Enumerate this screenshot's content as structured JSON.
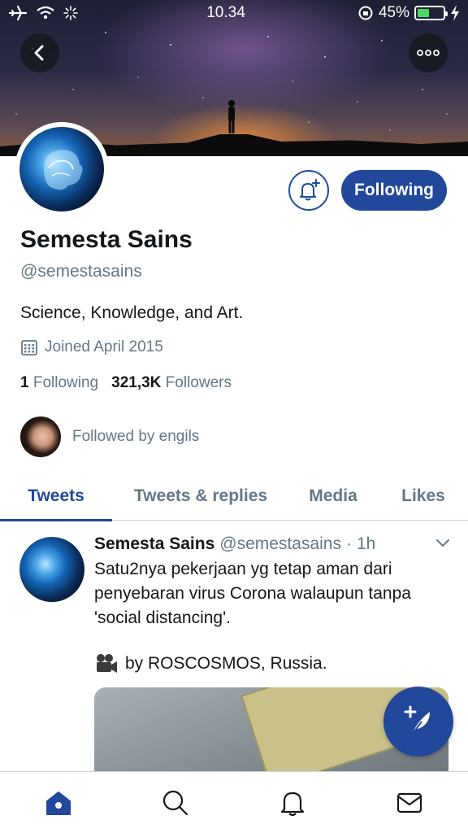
{
  "status_bar": {
    "time": "10.34",
    "battery_percent": "45%",
    "battery_level": 0.45
  },
  "header": {
    "back_icon": "back-arrow-icon",
    "more_icon": "more-dots-icon"
  },
  "profile": {
    "name": "Semesta Sains",
    "handle": "@semestasains",
    "bio": "Science, Knowledge, and Art.",
    "joined": "Joined April 2015",
    "following_count": "1",
    "following_label": "Following",
    "followers_count": "321,3K",
    "followers_label": "Followers",
    "followed_by": "Followed by engils",
    "follow_button_label": "Following"
  },
  "tabs": [
    {
      "label": "Tweets",
      "active": true
    },
    {
      "label": "Tweets & replies",
      "active": false
    },
    {
      "label": "Media",
      "active": false
    },
    {
      "label": "Likes",
      "active": false
    }
  ],
  "tweet": {
    "author_name": "Semesta Sains",
    "author_handle": "@semestasains",
    "separator": "·",
    "time": "1h",
    "text_line1": "Satu2nya pekerjaan yg tetap aman dari penyebaran virus Corona walaupun tanpa 'social distancing'.",
    "credit": "by ROSCOSMOS, Russia."
  },
  "bottom_nav": [
    {
      "name": "home",
      "icon": "home-icon",
      "active": true
    },
    {
      "name": "search",
      "icon": "search-icon",
      "active": false
    },
    {
      "name": "notifications",
      "icon": "bell-icon",
      "active": false
    },
    {
      "name": "messages",
      "icon": "mail-icon",
      "active": false
    }
  ],
  "colors": {
    "accent": "#21489a",
    "secondary_text": "#657786",
    "primary_text": "#14171a"
  }
}
